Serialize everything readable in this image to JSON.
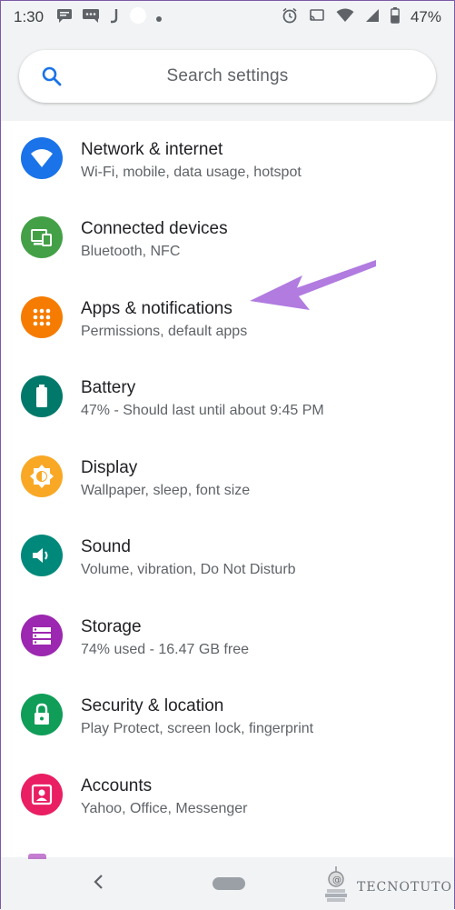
{
  "status_bar": {
    "time": "1:30",
    "battery_percent": "47%",
    "left_icons": [
      "message-icon",
      "chat-icon",
      "j-app-icon",
      "circle-app-icon",
      "dot-icon"
    ],
    "right_icons": [
      "alarm-icon",
      "cast-icon",
      "wifi-icon",
      "signal-icon",
      "battery-icon"
    ]
  },
  "search": {
    "placeholder": "Search settings"
  },
  "settings": [
    {
      "title": "Network & internet",
      "subtitle": "Wi-Fi, mobile, data usage, hotspot",
      "icon": "wifi-icon",
      "color": "#1a73e8"
    },
    {
      "title": "Connected devices",
      "subtitle": "Bluetooth, NFC",
      "icon": "devices-icon",
      "color": "#43a047"
    },
    {
      "title": "Apps & notifications",
      "subtitle": "Permissions, default apps",
      "icon": "apps-grid-icon",
      "color": "#f57c00"
    },
    {
      "title": "Battery",
      "subtitle": "47% - Should last until about 9:45 PM",
      "icon": "battery-icon",
      "color": "#00796b"
    },
    {
      "title": "Display",
      "subtitle": "Wallpaper, sleep, font size",
      "icon": "brightness-icon",
      "color": "#f9a825"
    },
    {
      "title": "Sound",
      "subtitle": "Volume, vibration, Do Not Disturb",
      "icon": "volume-icon",
      "color": "#00897b"
    },
    {
      "title": "Storage",
      "subtitle": "74% used - 16.47 GB free",
      "icon": "storage-icon",
      "color": "#9c27b0"
    },
    {
      "title": "Security & location",
      "subtitle": "Play Protect, screen lock, fingerprint",
      "icon": "lock-icon",
      "color": "#0f9d58"
    },
    {
      "title": "Accounts",
      "subtitle": "Yahoo, Office, Messenger",
      "icon": "account-icon",
      "color": "#e91e63"
    }
  ],
  "annotation": {
    "icon": "arrow-pointer",
    "color": "#b17be0"
  },
  "nav_bar": {
    "icons": [
      "back-icon",
      "home-pill-icon"
    ],
    "watermark": "TECNOTUTO"
  }
}
